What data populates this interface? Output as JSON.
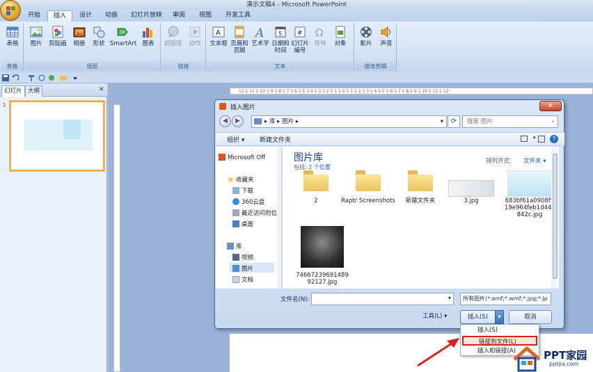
{
  "window": {
    "title": "演示文稿4 - Microsoft PowerPoint"
  },
  "tabs": [
    "开始",
    "插入",
    "设计",
    "动画",
    "幻灯片放映",
    "审阅",
    "视图",
    "开发工具"
  ],
  "active_tab": "插入",
  "ribbon": {
    "groups": [
      {
        "label": "表格",
        "buttons": [
          {
            "label": "表格",
            "icon": "table-icon",
            "enabled": true
          }
        ]
      },
      {
        "label": "插图",
        "buttons": [
          {
            "label": "图片",
            "icon": "picture-icon",
            "enabled": true
          },
          {
            "label": "剪贴画",
            "icon": "clipart-icon",
            "enabled": true
          },
          {
            "label": "相册",
            "icon": "photo-album-icon",
            "enabled": true
          },
          {
            "label": "形状",
            "icon": "shapes-icon",
            "enabled": true
          },
          {
            "label": "SmartArt",
            "icon": "smartart-icon",
            "enabled": true
          },
          {
            "label": "图表",
            "icon": "chart-icon",
            "enabled": true
          }
        ]
      },
      {
        "label": "链接",
        "buttons": [
          {
            "label": "超链接",
            "icon": "hyperlink-icon",
            "enabled": false
          },
          {
            "label": "动作",
            "icon": "action-icon",
            "enabled": false
          }
        ]
      },
      {
        "label": "文本",
        "buttons": [
          {
            "label": "文本框",
            "icon": "textbox-icon",
            "enabled": true
          },
          {
            "label": "页眉和页脚",
            "icon": "header-footer-icon",
            "enabled": true
          },
          {
            "label": "艺术字",
            "icon": "wordart-icon",
            "enabled": true
          },
          {
            "label": "日期和时间",
            "icon": "date-time-icon",
            "enabled": true
          },
          {
            "label": "幻灯片编号",
            "icon": "slide-number-icon",
            "enabled": true
          },
          {
            "label": "符号",
            "icon": "symbol-icon",
            "enabled": false
          },
          {
            "label": "对象",
            "icon": "object-icon",
            "enabled": true
          }
        ]
      },
      {
        "label": "媒体剪辑",
        "buttons": [
          {
            "label": "影片",
            "icon": "movie-icon",
            "enabled": true
          },
          {
            "label": "声音",
            "icon": "sound-icon",
            "enabled": true
          }
        ]
      }
    ]
  },
  "panel": {
    "tab_slides": "幻灯片",
    "tab_outline": "大纲",
    "close": "✕",
    "slide_number": "1"
  },
  "ruler": {
    "marks": "·12·1·11·1·10·1·9·1·8·1·7·1·6·1·5·1·4·1·3·1·2·1·1·1·0·1·1·1·2·1·3·1·4·1·5·1·6·1·7·1·8·1·9·1·10·1·11·1·12·"
  },
  "dialog": {
    "title": "插入图片",
    "close": "✕",
    "address": [
      "库",
      "图片"
    ],
    "search_placeholder": "搜索 图片",
    "toolbar": {
      "organize": "组织 ▾",
      "new_folder": "新建文件夹"
    },
    "library": {
      "title": "图片库",
      "includes": "包括:",
      "locations": "2 个位置",
      "sort_label": "排列方式:",
      "sort_value": "文件夹 ▾"
    },
    "tree": {
      "top": "Microsoft Off",
      "favorites": "收藏夹",
      "items": [
        "下载",
        "360云盘",
        "最近访问的位",
        "桌面"
      ],
      "library": "库",
      "lib_items": [
        "视频",
        "图片",
        "文档"
      ]
    },
    "files": [
      {
        "name": "2",
        "kind": "folder"
      },
      {
        "name": "Raptr Screenshots",
        "kind": "folder"
      },
      {
        "name": "新建文件夹",
        "kind": "folder"
      },
      {
        "name": "3.jpg",
        "kind": "image"
      },
      {
        "name": "683bf61a0908f919e964feb1d44c842c.jpg",
        "kind": "image"
      },
      {
        "name": "7466723969148992127.jpg",
        "kind": "image"
      }
    ],
    "filename_label": "文件名(N):",
    "filename_value": "",
    "filter_value": "所有图片(*.emf;*.wmf;*.jpg;*.jp",
    "tools": "工具(L)",
    "insert": "插入(S)",
    "cancel": "取消"
  },
  "dropdown": [
    "插入(S)",
    "链接到文件(L)",
    "插入和链接(A)"
  ],
  "logo": {
    "text": "PPT家园",
    "sub": "pptjia.com"
  }
}
